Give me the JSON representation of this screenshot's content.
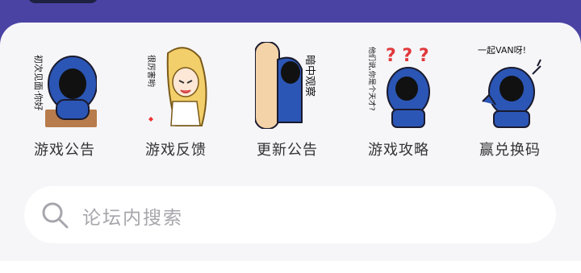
{
  "menu": {
    "items": [
      {
        "label": "游戏公告",
        "icon": "hooded-boy-greeting-icon",
        "sticker_text": "初次见面·你好"
      },
      {
        "label": "游戏反馈",
        "icon": "blonde-girl-praise-icon",
        "sticker_text": "很厉害哟"
      },
      {
        "label": "更新公告",
        "icon": "peeking-hooded-boy-icon",
        "sticker_text": "暗中观察"
      },
      {
        "label": "游戏攻略",
        "icon": "confused-hooded-boy-icon",
        "sticker_text": "他们说,你是个天才?"
      },
      {
        "label": "赢兑换码",
        "icon": "waving-hooded-boy-icon",
        "sticker_text": "一起VAN呀!"
      }
    ]
  },
  "search": {
    "placeholder": "论坛内搜索",
    "icon": "search-icon"
  },
  "colors": {
    "banner": "#4b43a4",
    "card": "#f6f6f9",
    "hood": "#2b56b5",
    "label": "#333333",
    "placeholder": "#a6a6ac"
  }
}
